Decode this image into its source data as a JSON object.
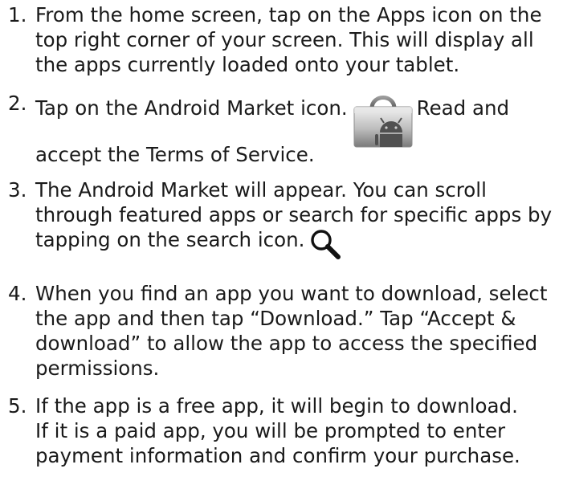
{
  "steps": [
    {
      "number": "1.",
      "lines": [
        "From the home screen, tap on the Apps icon on the",
        "top right corner of your screen. This will display all",
        "the apps currently loaded onto your tablet."
      ]
    },
    {
      "number": "2.",
      "line1_before": "Tap on the Android Market icon.",
      "line1_after": "Read and",
      "line2": "accept the Terms of Service.",
      "icon": "android-market-icon"
    },
    {
      "number": "3.",
      "lines": [
        "The Android Market will appear. You can scroll",
        "through featured apps or search for specific apps by"
      ],
      "last_line": "tapping on the search icon.",
      "icon": "magnifying-glass-icon"
    },
    {
      "number": "4.",
      "lines": [
        "When you find an app you want to download, select",
        "the app and then tap “Download.” Tap “Accept &",
        "download” to allow the app to access the specified",
        "permissions."
      ]
    },
    {
      "number": "5.",
      "lines": [
        "If the app is a free app, it will begin to download.",
        "If it is a paid app, you will be prompted to enter",
        "payment information and confirm your purchase."
      ]
    }
  ]
}
